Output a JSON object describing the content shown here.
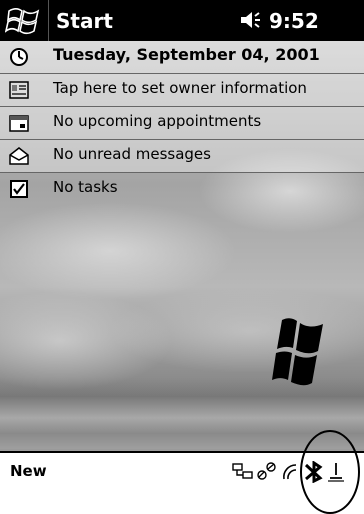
{
  "title_bar": {
    "title": "Start",
    "clock": "9:52",
    "start_icon": "windows-flag-icon",
    "volume_icon": "speaker-icon"
  },
  "today": {
    "date": "Tuesday, September 04, 2001",
    "owner": "Tap here to set owner information",
    "appointments": "No upcoming appointments",
    "messages": "No unread messages",
    "tasks": "No tasks"
  },
  "command_bar": {
    "new_label": "New",
    "tray_icons": [
      "connectivity-icon",
      "connection-chain-icon",
      "infrared-icon",
      "bluetooth-icon",
      "power-plug-icon"
    ]
  }
}
